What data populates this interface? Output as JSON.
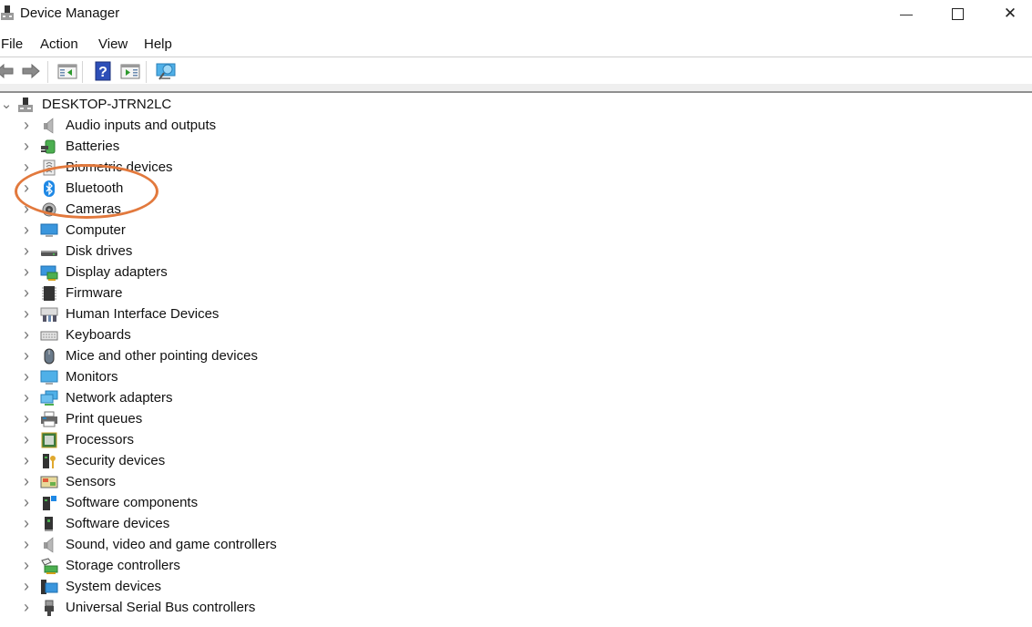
{
  "window": {
    "title": "Device Manager",
    "minimize_glyph": "—",
    "maximize_glyph": "☐",
    "close_glyph": "✕"
  },
  "menu": [
    "File",
    "Action",
    "View",
    "Help"
  ],
  "toolbar": {
    "buttons": [
      {
        "name": "back-icon"
      },
      {
        "name": "forward-icon"
      },
      {
        "name": "show-hide-console-tree-icon"
      },
      {
        "name": "help-icon",
        "glyph": "?"
      },
      {
        "name": "show-hide-action-pane-icon"
      },
      {
        "name": "scan-hardware-changes-icon"
      }
    ]
  },
  "tree": {
    "root": {
      "label": "DESKTOP-JTRN2LC",
      "expanded": true,
      "chevron": "⌄"
    },
    "chevron_collapsed": "›",
    "items": [
      {
        "label": "Audio inputs and outputs",
        "icon": "speaker-icon"
      },
      {
        "label": "Batteries",
        "icon": "battery-icon"
      },
      {
        "label": "Biometric devices",
        "icon": "biometric-icon"
      },
      {
        "label": "Bluetooth",
        "icon": "bluetooth-icon"
      },
      {
        "label": "Cameras",
        "icon": "camera-icon"
      },
      {
        "label": "Computer",
        "icon": "computer-icon"
      },
      {
        "label": "Disk drives",
        "icon": "disk-drive-icon"
      },
      {
        "label": "Display adapters",
        "icon": "display-adapter-icon"
      },
      {
        "label": "Firmware",
        "icon": "firmware-icon"
      },
      {
        "label": "Human Interface Devices",
        "icon": "hid-icon"
      },
      {
        "label": "Keyboards",
        "icon": "keyboard-icon"
      },
      {
        "label": "Mice and other pointing devices",
        "icon": "mouse-icon"
      },
      {
        "label": "Monitors",
        "icon": "monitor-icon"
      },
      {
        "label": "Network adapters",
        "icon": "network-adapter-icon"
      },
      {
        "label": "Print queues",
        "icon": "printer-icon"
      },
      {
        "label": "Processors",
        "icon": "processor-icon"
      },
      {
        "label": "Security devices",
        "icon": "security-device-icon"
      },
      {
        "label": "Sensors",
        "icon": "sensor-icon"
      },
      {
        "label": "Software components",
        "icon": "software-component-icon"
      },
      {
        "label": "Software devices",
        "icon": "software-device-icon"
      },
      {
        "label": "Sound, video and game controllers",
        "icon": "sound-controller-icon"
      },
      {
        "label": "Storage controllers",
        "icon": "storage-controller-icon"
      },
      {
        "label": "System devices",
        "icon": "system-device-icon"
      },
      {
        "label": "Universal Serial Bus controllers",
        "icon": "usb-icon"
      }
    ]
  },
  "annotation": {
    "highlighted_item": "Bluetooth",
    "color": "#e2793d"
  }
}
